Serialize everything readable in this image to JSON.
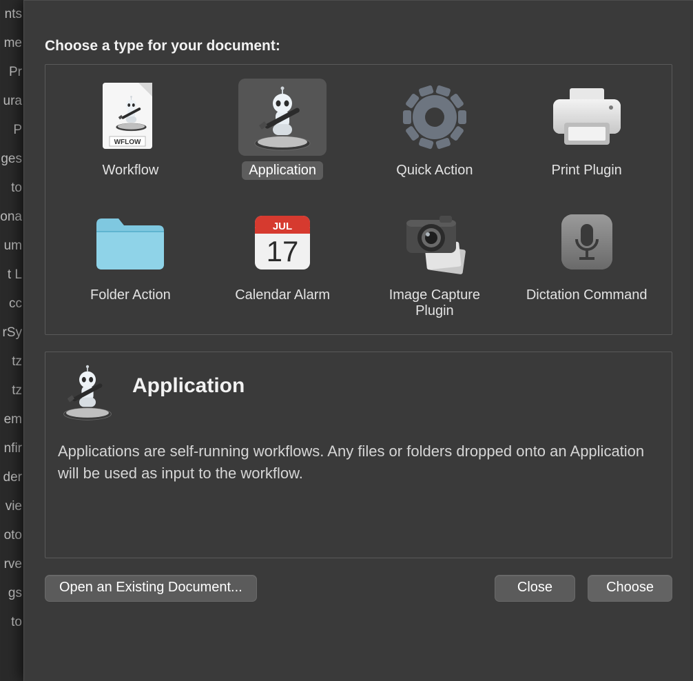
{
  "heading": "Choose a type for your document:",
  "types": [
    {
      "label": "Workflow",
      "icon": "workflow",
      "selected": false
    },
    {
      "label": "Application",
      "icon": "automator-app",
      "selected": true
    },
    {
      "label": "Quick Action",
      "icon": "gear",
      "selected": false
    },
    {
      "label": "Print Plugin",
      "icon": "printer",
      "selected": false
    },
    {
      "label": "Folder Action",
      "icon": "folder",
      "selected": false
    },
    {
      "label": "Calendar Alarm",
      "icon": "calendar",
      "selected": false
    },
    {
      "label": "Image Capture Plugin",
      "icon": "camera",
      "selected": false
    },
    {
      "label": "Dictation Command",
      "icon": "microphone",
      "selected": false
    }
  ],
  "calendar": {
    "month": "JUL",
    "day": "17"
  },
  "workflow_badge": "WFLOW",
  "description": {
    "title": "Application",
    "body": "Applications are self-running workflows. Any files or folders dropped onto an Application will be used as input to the workflow."
  },
  "buttons": {
    "open": "Open an Existing Document...",
    "close": "Close",
    "choose": "Choose"
  },
  "bg_items": [
    "nts",
    "me",
    "Pr",
    "ura",
    "P",
    "ges",
    "to",
    "ona",
    "um",
    "t L",
    "cc",
    "",
    "rSy",
    "tz",
    "tz",
    "",
    "em",
    "nfir",
    "der",
    "vie",
    "oto",
    "rve",
    "gs",
    "to"
  ]
}
